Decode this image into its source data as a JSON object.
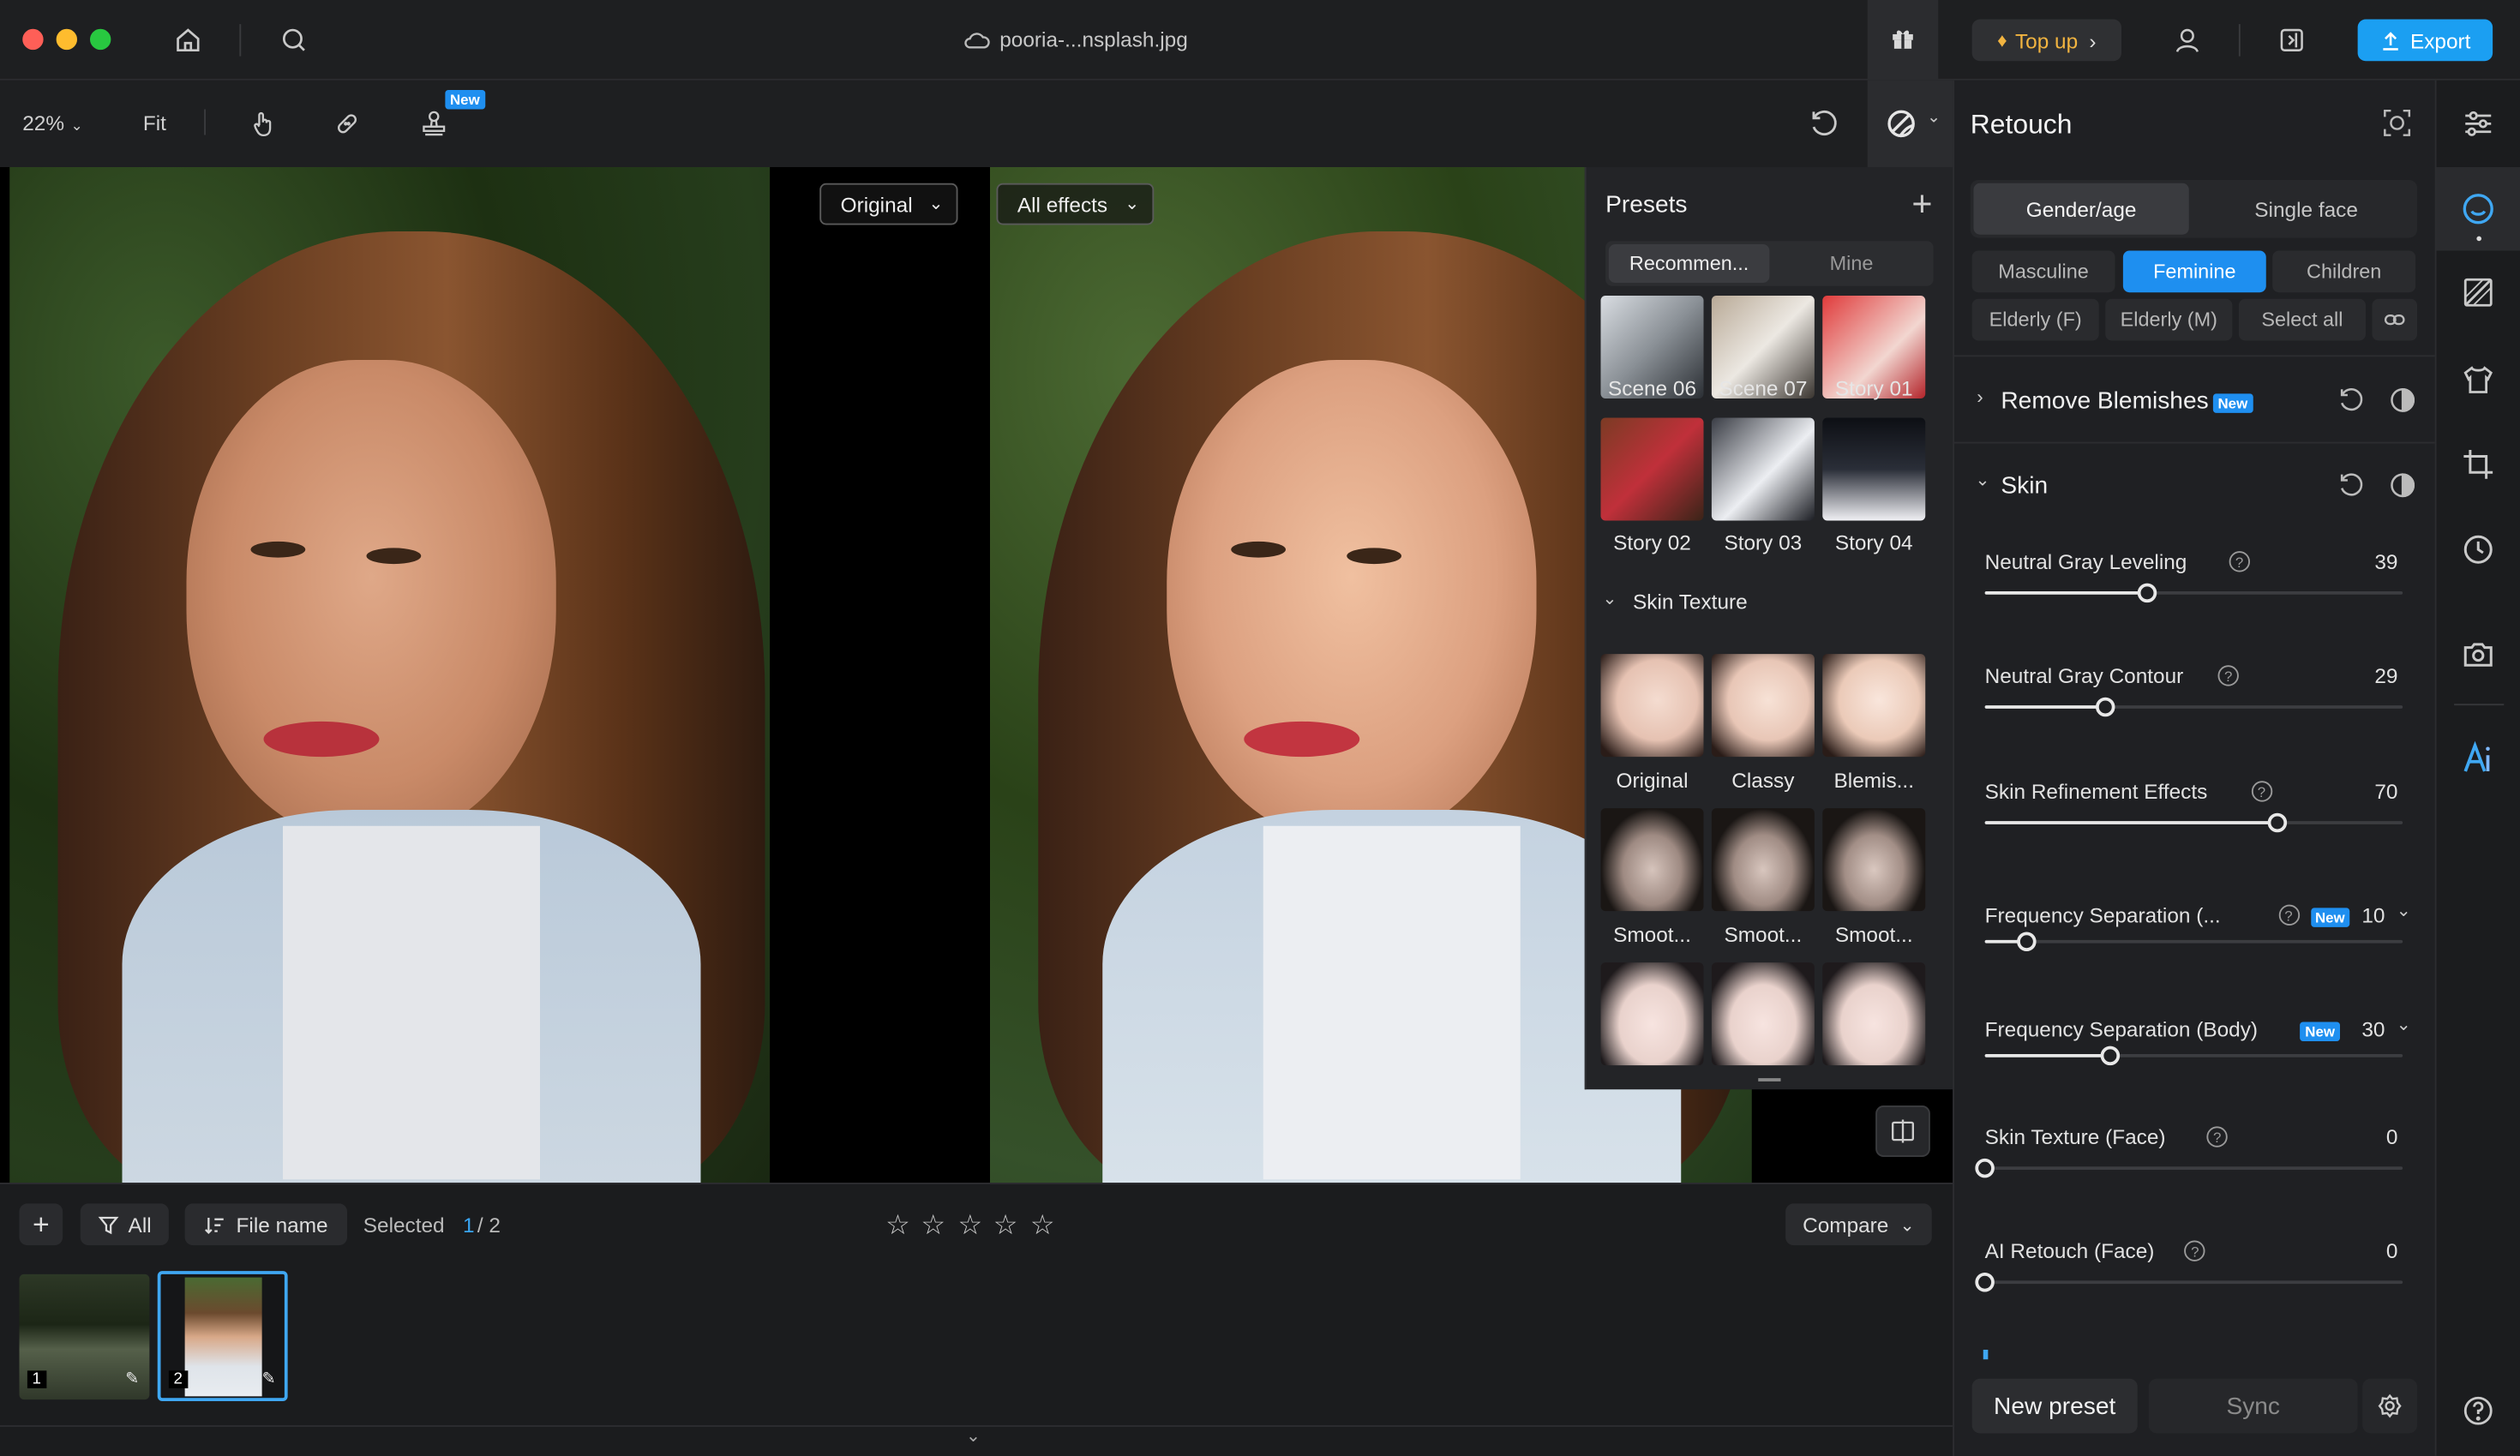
{
  "window": {
    "filename": "pooria-...nsplash.jpg"
  },
  "header": {
    "topup_label": "Top up",
    "export_label": "Export"
  },
  "toolbar": {
    "zoom": "22%",
    "fit_label": "Fit",
    "new_badge": "New"
  },
  "canvas": {
    "left_view": "Original",
    "right_view": "All effects"
  },
  "presets": {
    "title": "Presets",
    "tabs": [
      "Recommen...",
      "Mine"
    ],
    "scene_items": [
      "Scene 06",
      "Scene 07",
      "Story 01",
      "Story 02",
      "Story 03",
      "Story 04"
    ],
    "skin_texture_title": "Skin Texture",
    "skin_items": [
      "Original",
      "Classy",
      "Blemis...",
      "Smoot...",
      "Smoot...",
      "Smoot..."
    ]
  },
  "bottom": {
    "filter_all": "All",
    "sort_label": "File name",
    "selected_label": "Selected",
    "selected_count": "1",
    "total_count": "/ 2",
    "compare_label": "Compare",
    "rating": 0,
    "thumbs": [
      {
        "index": "1"
      },
      {
        "index": "2"
      }
    ]
  },
  "retouch": {
    "title": "Retouch",
    "mode_tabs": [
      "Gender/age",
      "Single face"
    ],
    "gender_row1": [
      "Masculine",
      "Feminine",
      "Children"
    ],
    "gender_row2": [
      "Elderly (F)",
      "Elderly (M)",
      "Select all"
    ],
    "active_gender": "Feminine",
    "sections": {
      "remove_blemishes": "Remove Blemishes",
      "skin": "Skin"
    },
    "new_badge": "New",
    "sliders": [
      {
        "label": "Neutral Gray Leveling",
        "value": "39",
        "pct": 39
      },
      {
        "label": "Neutral Gray Contour",
        "value": "29",
        "pct": 29
      },
      {
        "label": "Skin Refinement Effects",
        "value": "70",
        "pct": 70
      },
      {
        "label": "Frequency Separation (...",
        "value": "10",
        "pct": 10
      },
      {
        "label": "Frequency Separation (Body)",
        "value": "30",
        "pct": 30
      },
      {
        "label": "Skin Texture (Face)",
        "value": "0",
        "pct": 0
      },
      {
        "label": "AI Retouch (Face)",
        "value": "0",
        "pct": 0
      }
    ],
    "new_preset_label": "New preset",
    "sync_label": "Sync"
  },
  "colors": {
    "accent": "#1f8ff0",
    "topup": "#f0a020"
  }
}
